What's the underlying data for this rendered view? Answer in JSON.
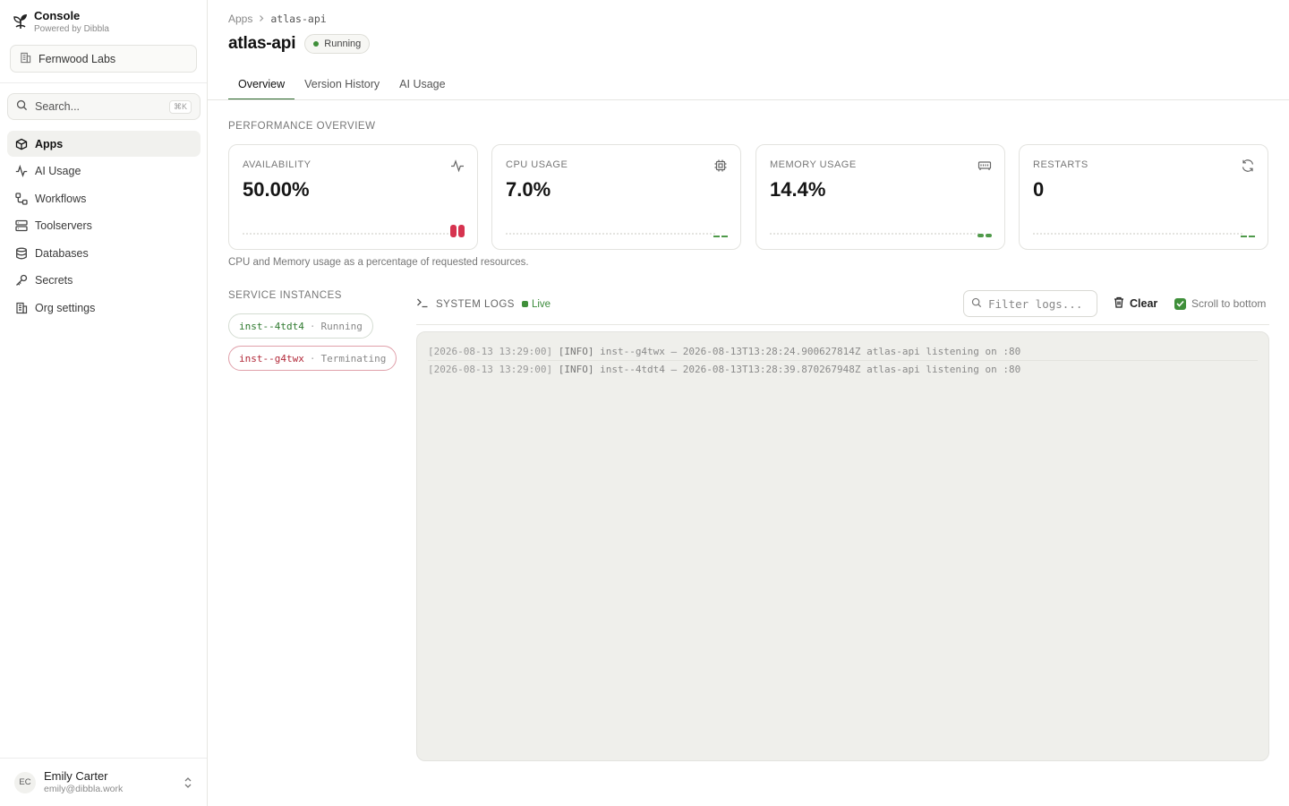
{
  "brand": {
    "title": "Console",
    "subtitle": "Powered by Dibbla"
  },
  "org": {
    "name": "Fernwood Labs",
    "icon": "building-icon"
  },
  "search": {
    "placeholder": "Search...",
    "shortcut": "⌘K"
  },
  "nav": [
    {
      "label": "Apps",
      "icon": "box-icon",
      "active": true
    },
    {
      "label": "AI Usage",
      "icon": "activity-icon",
      "active": false
    },
    {
      "label": "Workflows",
      "icon": "workflow-icon",
      "active": false
    },
    {
      "label": "Toolservers",
      "icon": "server-icon",
      "active": false
    },
    {
      "label": "Databases",
      "icon": "database-icon",
      "active": false
    },
    {
      "label": "Secrets",
      "icon": "key-icon",
      "active": false
    },
    {
      "label": "Org settings",
      "icon": "building-icon",
      "active": false
    }
  ],
  "user": {
    "initials": "EC",
    "name": "Emily Carter",
    "email": "emily@dibbla.work"
  },
  "breadcrumb": {
    "root": "Apps",
    "current": "atlas-api"
  },
  "page": {
    "title": "atlas-api",
    "status": "Running"
  },
  "tabs": [
    {
      "label": "Overview",
      "active": true
    },
    {
      "label": "Version History",
      "active": false
    },
    {
      "label": "AI Usage",
      "active": false
    }
  ],
  "performance": {
    "label": "PERFORMANCE OVERVIEW",
    "caption": "CPU and Memory usage as a percentage of requested resources.",
    "cards": [
      {
        "label": "AVAILABILITY",
        "value": "50.00%",
        "icon": "activity-icon",
        "spark_color": "#d6334f"
      },
      {
        "label": "CPU USAGE",
        "value": "7.0%",
        "icon": "cpu-icon",
        "spark_color": "#4f9a4a"
      },
      {
        "label": "MEMORY USAGE",
        "value": "14.4%",
        "icon": "memory-icon",
        "spark_color": "#4f9a4a"
      },
      {
        "label": "RESTARTS",
        "value": "0",
        "icon": "refresh-icon",
        "spark_color": "#4f9a4a"
      }
    ]
  },
  "instances": {
    "label": "SERVICE INSTANCES",
    "items": [
      {
        "id": "inst--4tdt4",
        "separator": "·",
        "state": "Running",
        "status_color": "#2f7a2f"
      },
      {
        "id": "inst--g4twx",
        "separator": "·",
        "state": "Terminating",
        "status_color": "#b22a3a"
      }
    ]
  },
  "logs": {
    "title": "SYSTEM LOGS",
    "live_label": "Live",
    "filter_placeholder": "Filter logs...",
    "clear_label": "Clear",
    "scroll_label": "Scroll to bottom",
    "scroll_checked": true,
    "lines": [
      {
        "ts": "[2026-08-13 13:29:00]",
        "level": "[INFO]",
        "message": "inst--g4twx — 2026-08-13T13:28:24.900627814Z atlas-api listening on :80"
      },
      {
        "ts": "[2026-08-13 13:29:00]",
        "level": "[INFO]",
        "message": "inst--4tdt4 — 2026-08-13T13:28:39.870267948Z atlas-api listening on :80"
      }
    ]
  },
  "colors": {
    "accent": "#3f8f3a",
    "danger": "#d6334f",
    "border": "#e3e3df"
  }
}
